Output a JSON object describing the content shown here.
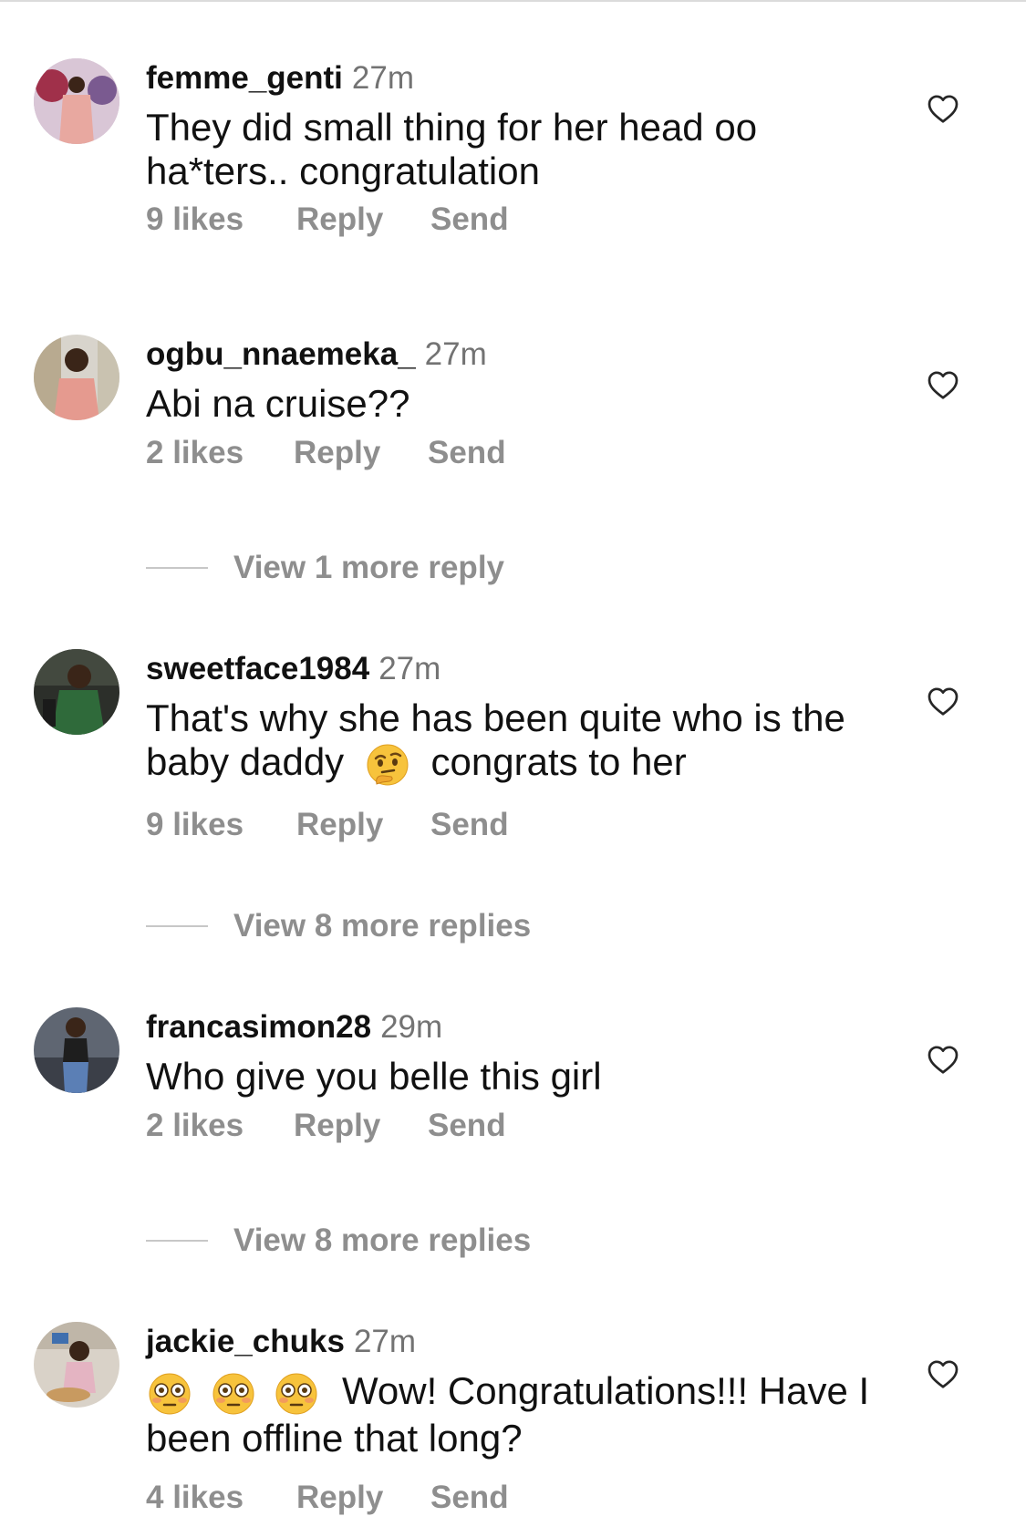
{
  "comments": [
    {
      "username": "femme_genti",
      "time": "27m",
      "text_lines": [
        "They did small thing for her head oo",
        "ha*ters.. congratulation"
      ],
      "likes": "9 likes",
      "reply": "Reply",
      "send": "Send"
    },
    {
      "username": "ogbu_nnaemeka_",
      "time": "27m",
      "text_lines": [
        "Abi na cruise??"
      ],
      "likes": "2 likes",
      "reply": "Reply",
      "send": "Send",
      "view_more": "View 1 more reply"
    },
    {
      "username": "sweetface1984",
      "time": "27m",
      "text_line1": "That's why she has been quite who is the",
      "text_line2_before": "baby daddy",
      "text_line2_emoji": "thinking-face-emoji",
      "text_line2_after": "congrats to her",
      "likes": "9 likes",
      "reply": "Reply",
      "send": "Send",
      "view_more": "View 8 more replies"
    },
    {
      "username": "francasimon28",
      "time": "29m",
      "text_lines": [
        "Who give you belle this girl"
      ],
      "likes": "2 likes",
      "reply": "Reply",
      "send": "Send",
      "view_more": "View 8 more replies"
    },
    {
      "username": "jackie_chuks",
      "time": "27m",
      "text_line1_emojis": [
        "flushed-face-emoji",
        "flushed-face-emoji",
        "flushed-face-emoji"
      ],
      "text_line1": "Wow! Congratulations!!! Have I",
      "text_line2": "been offline that long?",
      "likes": "4 likes",
      "reply": "Reply",
      "send": "Send"
    }
  ],
  "icons": {
    "like": "heart-outline-icon"
  },
  "colors": {
    "text": "#111111",
    "secondary": "#8e8e8e",
    "time": "#737373"
  }
}
